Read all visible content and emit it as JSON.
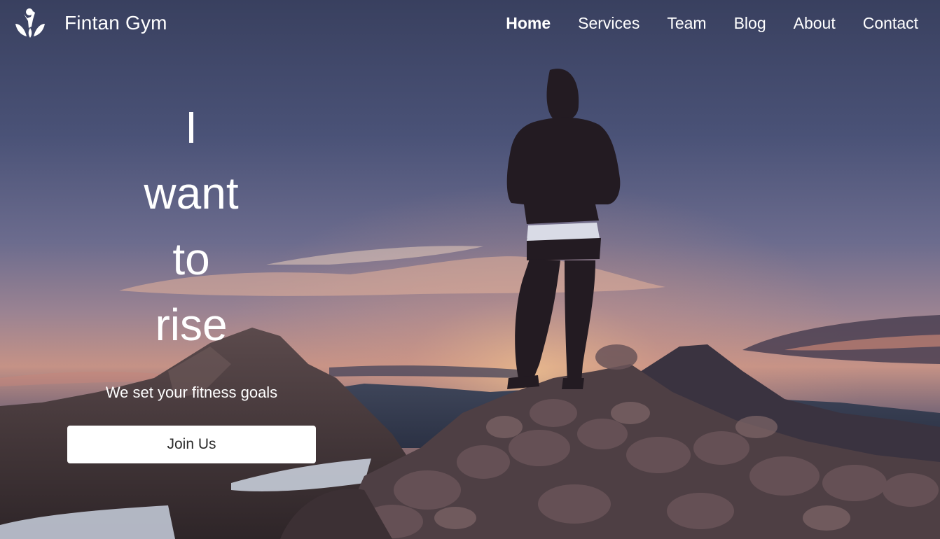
{
  "brand": {
    "name": "Fintan Gym",
    "logo_icon": "person-leaves-logo-icon"
  },
  "nav": {
    "items": [
      {
        "label": "Home",
        "active": true
      },
      {
        "label": "Services",
        "active": false
      },
      {
        "label": "Team",
        "active": false
      },
      {
        "label": "Blog",
        "active": false
      },
      {
        "label": "About",
        "active": false
      },
      {
        "label": "Contact",
        "active": false
      }
    ]
  },
  "hero": {
    "headline_words": [
      "I",
      "want",
      "to",
      "rise"
    ],
    "tagline": "We set your fitness goals",
    "cta_label": "Join Us"
  },
  "colors": {
    "text": "#ffffff",
    "button_bg": "#ffffff",
    "button_text": "#2b2b2b"
  }
}
